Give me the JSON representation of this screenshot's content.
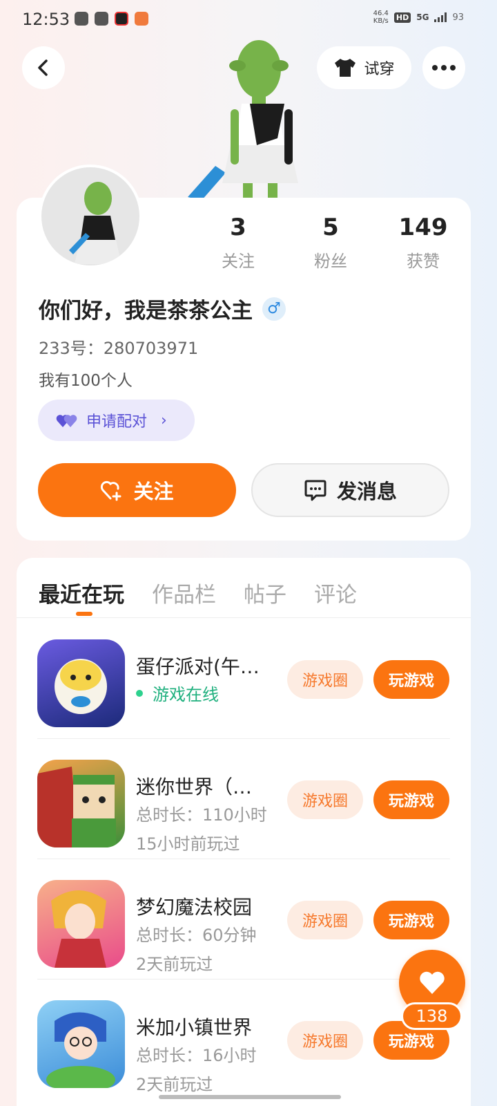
{
  "status_bar": {
    "time": "12:53",
    "net_speed": "46.4",
    "net_unit": "KB/s",
    "hd": "HD",
    "network": "5G",
    "battery": "93"
  },
  "header": {
    "try_on_label": "试穿"
  },
  "profile": {
    "stats": [
      {
        "value": "3",
        "label": "关注"
      },
      {
        "value": "5",
        "label": "粉丝"
      },
      {
        "value": "149",
        "label": "获赞"
      }
    ],
    "nickname": "你们好，我是茶茶公主",
    "gender_symbol": "♂",
    "uid": "233号：280703971",
    "bio": "我有100个人",
    "pair_label": "申请配对",
    "follow_label": "关注",
    "message_label": "发消息"
  },
  "tabs": [
    {
      "label": "最近在玩",
      "active": true
    },
    {
      "label": "作品栏",
      "active": false
    },
    {
      "label": "帖子",
      "active": false
    },
    {
      "label": "评论",
      "active": false
    }
  ],
  "games": [
    {
      "name": "蛋仔派对(午…",
      "line1": "游戏在线",
      "line2": "",
      "online": true,
      "circle_label": "游戏圈",
      "play_label": "玩游戏"
    },
    {
      "name": "迷你世界（…",
      "line1": "总时长：110小时",
      "line2": "15小时前玩过",
      "online": false,
      "circle_label": "游戏圈",
      "play_label": "玩游戏"
    },
    {
      "name": "梦幻魔法校园",
      "line1": "总时长：60分钟",
      "line2": "2天前玩过",
      "online": false,
      "circle_label": "游戏圈",
      "play_label": "玩游戏"
    },
    {
      "name": "米加小镇世界",
      "line1": "总时长：16小时",
      "line2": "2天前玩过",
      "online": false,
      "circle_label": "游戏圈",
      "play_label": "玩游戏"
    }
  ],
  "like": {
    "count": "138"
  },
  "colors": {
    "accent": "#fb7410",
    "online": "#1fb07e",
    "pair": "#5b52d6"
  }
}
